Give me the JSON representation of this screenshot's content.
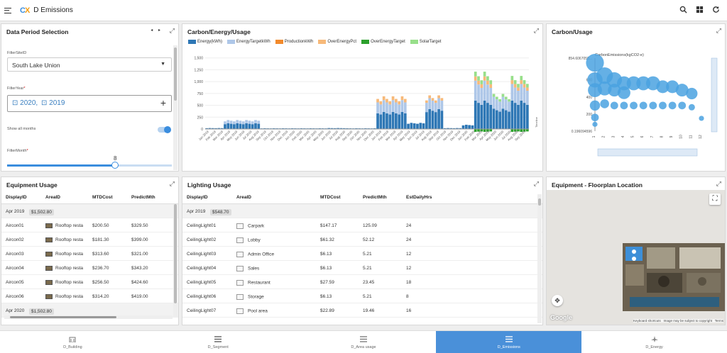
{
  "app": {
    "logo_a": "C",
    "logo_b": "X",
    "title": "D Emissions"
  },
  "colors": {
    "accent": "#4a90d9",
    "energy": "#2e77b5",
    "target": "#aec7e8",
    "production": "#f28a2c",
    "overpct": "#f7b979",
    "overtarget": "#2ca02c",
    "solar": "#98df8a",
    "bubble": "#4aa2e0"
  },
  "data_period": {
    "title": "Data Period Selection",
    "site_label": "FilterSiteID",
    "site_value": "South Lake Union",
    "year_label": "FilterYear",
    "year_req": "*",
    "year_values": [
      "2020,",
      "2019"
    ],
    "show_all_label": "Show all months",
    "month_label": "FilterMonth",
    "month_req": "*",
    "slider_value": "8"
  },
  "carbon_energy": {
    "title": "Carbon/Energy/Usage",
    "legend": [
      "Energy(kWh)",
      "EnergyTargetkWh",
      "ProductionkWh",
      "OverEnergyPct",
      "OverEnergyTarget",
      "SolarTarget"
    ],
    "side_label": "Timeline"
  },
  "carbon_usage": {
    "title": "Carbon/Usage",
    "series_label": "CarbonEmissions(kgCO2-e)"
  },
  "equipment": {
    "title": "Equipment Usage",
    "headers": [
      "DisplayID",
      "AreaID",
      "MTDCost",
      "PredictMth"
    ],
    "group1": "Apr 2019",
    "group1_total": "$1,502.80",
    "group2": "Apr 2020",
    "group2_total": "$1,502.80",
    "rows": [
      [
        "Aircon01",
        "Rooftop resta",
        "$200.50",
        "$329.50"
      ],
      [
        "Aircon02",
        "Rooftop resta",
        "$181.30",
        "$399.00"
      ],
      [
        "Aircon03",
        "Rooftop resta",
        "$313.60",
        "$321.00"
      ],
      [
        "Aircon04",
        "Rooftop resta",
        "$236.70",
        "$343.20"
      ],
      [
        "Aircon05",
        "Rooftop resta",
        "$256.50",
        "$424.60"
      ],
      [
        "Aircon06",
        "Rooftop resta",
        "$314.20",
        "$419.00"
      ]
    ]
  },
  "lighting": {
    "title": "Lighting Usage",
    "headers": [
      "DisplayID",
      "AreaID",
      "MTDCost",
      "PredictMth",
      "EstDailyHrs"
    ],
    "group1": "Apr 2019",
    "group1_total": "$548.70",
    "rows": [
      [
        "CeilingLight01",
        "Carpark",
        "$147.17",
        "125.09",
        "24"
      ],
      [
        "CeilingLight02",
        "Lobby",
        "$61.32",
        "52.12",
        "24"
      ],
      [
        "CeilingLight03",
        "Admin Office",
        "$6.13",
        "5.21",
        "12"
      ],
      [
        "CeilingLight04",
        "Sales",
        "$6.13",
        "5.21",
        "12"
      ],
      [
        "CeilingLight05",
        "Restaurant",
        "$27.59",
        "23.45",
        "18"
      ],
      [
        "CeilingLight06",
        "Storage",
        "$6.13",
        "5.21",
        "8"
      ],
      [
        "CeilingLight07",
        "Pool area",
        "$22.89",
        "19.46",
        "16"
      ]
    ]
  },
  "floorplan": {
    "title": "Equipment - Floorplan Location",
    "google": "Google",
    "shortcuts": "Keyboard shortcuts",
    "copyright": "Image may be subject to copyright",
    "terms": "Terms"
  },
  "nav": [
    {
      "label": "D_Building",
      "icon": "building-icon"
    },
    {
      "label": "D_Segment",
      "icon": "list-icon"
    },
    {
      "label": "D_Area usage",
      "icon": "list-icon"
    },
    {
      "label": "D_Emissions",
      "icon": "list-icon",
      "active": true
    },
    {
      "label": "D_Energy",
      "icon": "plane-icon"
    }
  ],
  "chart_data": [
    {
      "type": "bar",
      "title": "Carbon/Energy/Usage",
      "xlabel": "",
      "ylabel": "",
      "ylim": [
        0,
        1600
      ],
      "yticks": [
        "0",
        "250",
        "500",
        "750",
        "1,000",
        "1,250",
        "1,500"
      ],
      "x_ticks": [
        "Jan 2019",
        "Feb 2019",
        "Mar 2019",
        "Apr 2019",
        "May 2019",
        "Jun 2019",
        "Jul 2019",
        "Aug 2019",
        "Sep 2019",
        "Oct 2019",
        "Nov 2019",
        "Dec 2019",
        "Jan 2020",
        "Feb 2020",
        "Mar 2020",
        "Apr 2020",
        "May 2020",
        "Jun 2020",
        "Jul 2020",
        "Aug 2020",
        "Sep 2020",
        "Oct 2020",
        "Nov 2020",
        "Dec 2020",
        "Jan 2019",
        "Feb 2019",
        "Mar 2019",
        "Apr 2019",
        "May 2019",
        "Jun 2019",
        "Jul 2019",
        "Aug 2019",
        "Sep 2019",
        "Oct 2019",
        "Nov 2019",
        "Dec 2019",
        "Jan 2020",
        "Feb 2020",
        "Mar 2020",
        "Apr 2020",
        "May 2020",
        "Jun 2020",
        "Jul 2020",
        "Aug 2020",
        "Sep 2020"
      ],
      "series": [
        {
          "name": "Energy(kWh)",
          "segments": [
            {
              "from": 0,
              "to": 6,
              "value": 20
            },
            {
              "from": 6,
              "to": 18,
              "value": 120
            },
            {
              "from": 18,
              "to": 40,
              "value": 15
            },
            {
              "from": 40,
              "to": 46,
              "value": 20
            },
            {
              "from": 46,
              "to": 56,
              "value": 15
            },
            {
              "from": 56,
              "to": 66,
              "value": 360
            },
            {
              "from": 66,
              "to": 72,
              "value": 130
            },
            {
              "from": 72,
              "to": 78,
              "value": 420
            },
            {
              "from": 78,
              "to": 84,
              "value": 20
            },
            {
              "from": 84,
              "to": 88,
              "value": 90
            },
            {
              "from": 88,
              "to": 94,
              "value": 600
            },
            {
              "from": 94,
              "to": 100,
              "value": 430
            },
            {
              "from": 100,
              "to": 106,
              "value": 600
            }
          ]
        },
        {
          "name": "EnergyTargetkWh",
          "segments": [
            {
              "from": 6,
              "to": 18,
              "value": 70
            },
            {
              "from": 56,
              "to": 66,
              "value": 250
            },
            {
              "from": 72,
              "to": 78,
              "value": 230
            },
            {
              "from": 88,
              "to": 94,
              "value": 420
            },
            {
              "from": 94,
              "to": 100,
              "value": 250
            },
            {
              "from": 100,
              "to": 106,
              "value": 350
            }
          ]
        },
        {
          "name": "ProductionkWh",
          "segments": []
        },
        {
          "name": "OverEnergyPct",
          "segments": [
            {
              "from": 56,
              "to": 66,
              "value": 80
            },
            {
              "from": 72,
              "to": 78,
              "value": 60
            },
            {
              "from": 88,
              "to": 94,
              "value": 90
            },
            {
              "from": 100,
              "to": 106,
              "value": 80
            }
          ]
        },
        {
          "name": "OverEnergyTarget",
          "segments": [
            {
              "from": 88,
              "to": 94,
              "value": -60
            },
            {
              "from": 100,
              "to": 106,
              "value": -60
            }
          ]
        },
        {
          "name": "SolarTarget",
          "segments": [
            {
              "from": 88,
              "to": 94,
              "value": 100
            },
            {
              "from": 94,
              "to": 100,
              "value": 60
            },
            {
              "from": 100,
              "to": 106,
              "value": 90
            }
          ]
        }
      ],
      "legend": "top"
    },
    {
      "type": "scatter",
      "title": "Carbon/Usage",
      "ylim": [
        0.196094596,
        854.6067058
      ],
      "yticks": [
        "0.196094596",
        "200",
        "400",
        "600",
        "854.6067058..."
      ],
      "xticks": [
        "1",
        "2",
        "3",
        "4",
        "5",
        "6",
        "7",
        "8",
        "9",
        "10",
        "11",
        "12"
      ],
      "points": [
        [
          1,
          800,
          14
        ],
        [
          1,
          600,
          12
        ],
        [
          1,
          480,
          11
        ],
        [
          1,
          300,
          8
        ],
        [
          1,
          160,
          6
        ],
        [
          1,
          80,
          4
        ],
        [
          2,
          650,
          13
        ],
        [
          2,
          500,
          11
        ],
        [
          2,
          320,
          7
        ],
        [
          3,
          600,
          12
        ],
        [
          3,
          480,
          10
        ],
        [
          3,
          300,
          6
        ],
        [
          4,
          560,
          11
        ],
        [
          4,
          450,
          10
        ],
        [
          4,
          300,
          6
        ],
        [
          5,
          560,
          11
        ],
        [
          5,
          300,
          6
        ],
        [
          6,
          560,
          11
        ],
        [
          6,
          300,
          6
        ],
        [
          7,
          560,
          11
        ],
        [
          7,
          300,
          6
        ],
        [
          8,
          520,
          10
        ],
        [
          8,
          300,
          6
        ],
        [
          9,
          520,
          10
        ],
        [
          9,
          300,
          6
        ],
        [
          10,
          480,
          10
        ],
        [
          10,
          300,
          6
        ],
        [
          11,
          440,
          9
        ],
        [
          11,
          280,
          5
        ],
        [
          12,
          150,
          4
        ]
      ],
      "legend": "top-left"
    }
  ]
}
